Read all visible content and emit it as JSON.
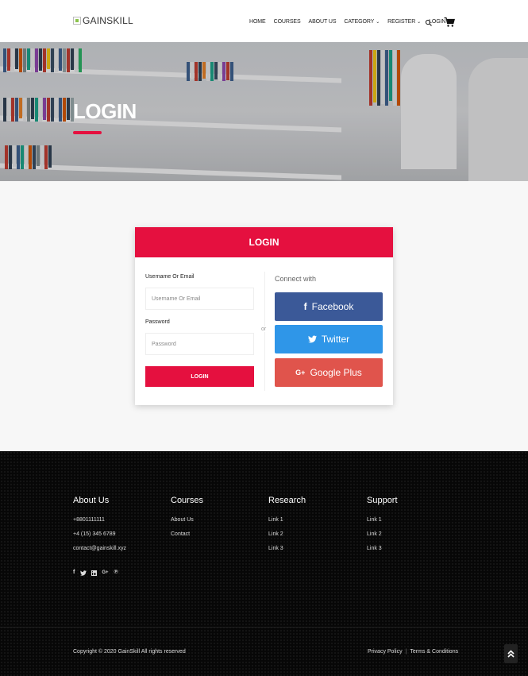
{
  "header": {
    "logo_text": "GAINSKILL",
    "nav": [
      {
        "label": "HOME",
        "has_caret": false
      },
      {
        "label": "COURSES",
        "has_caret": false
      },
      {
        "label": "ABOUT US",
        "has_caret": false
      },
      {
        "label": "CATEGORY",
        "has_caret": true
      },
      {
        "label": "REGISTER",
        "has_caret": true
      },
      {
        "label": "LOGIN",
        "has_caret": false
      }
    ],
    "icons": [
      "search-icon",
      "cart-icon"
    ]
  },
  "hero": {
    "title": "LOGIN",
    "accent_color": "#e5103f"
  },
  "login_card": {
    "title": "LOGIN",
    "username_label": "Username Or Email",
    "username_placeholder": "Username Or Email",
    "password_label": "Password",
    "password_placeholder": "Password",
    "submit_label": "LOGIN",
    "or_text": "or",
    "connect_text": "Connect with",
    "social": [
      {
        "label": "Facebook",
        "icon": "f",
        "color": "#3b5998"
      },
      {
        "label": "Twitter",
        "icon": "🐦",
        "color": "#2f96e8"
      },
      {
        "label": "Google Plus",
        "icon": "G+",
        "color": "#e0544c"
      }
    ]
  },
  "footer": {
    "columns": [
      {
        "title": "About Us",
        "links": [
          "+8801111111",
          "+4 (15) 345 6789",
          "contact@gainskill.xyz"
        ]
      },
      {
        "title": "Courses",
        "links": [
          "About Us",
          "Contact"
        ]
      },
      {
        "title": "Research",
        "links": [
          "Link 1",
          "Link 2",
          "Link 3"
        ]
      },
      {
        "title": "Support",
        "links": [
          "Link 1",
          "Link 2",
          "Link 3"
        ]
      }
    ],
    "social_icons": [
      "facebook-icon",
      "twitter-icon",
      "linkedin-icon",
      "google-plus-icon",
      "pinterest-icon"
    ],
    "copyright": "Copyright © 2020 GainSkill All rights reserved",
    "privacy": "Privacy Policy",
    "separator": "|",
    "terms": "Terms & Conditions"
  }
}
